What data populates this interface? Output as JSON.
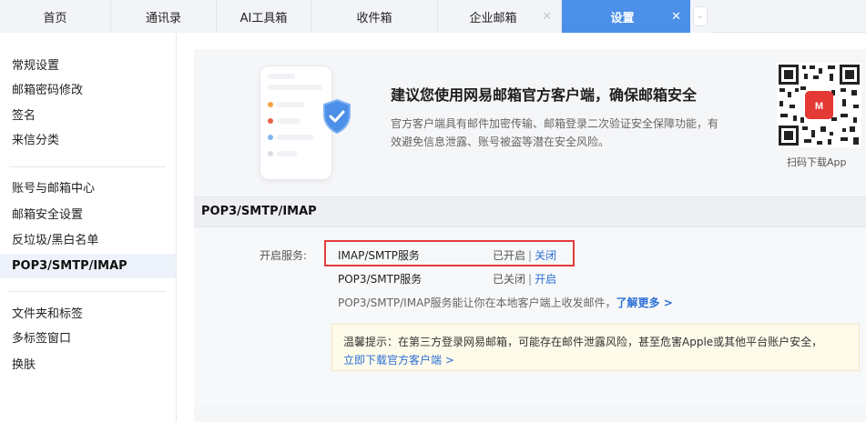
{
  "tabs": [
    {
      "label": "首页",
      "closable": false
    },
    {
      "label": "通讯录",
      "closable": false
    },
    {
      "label": "AI工具箱",
      "closable": false
    },
    {
      "label": "收件箱",
      "closable": false
    },
    {
      "label": "企业邮箱",
      "closable": true
    },
    {
      "label": "设置",
      "closable": true,
      "active": true
    }
  ],
  "sidebar": {
    "group1": [
      "常规设置",
      "邮箱密码修改",
      "签名",
      "来信分类"
    ],
    "group2": [
      "账号与邮箱中心",
      "邮箱安全设置",
      "反垃圾/黑白名单",
      "POP3/SMTP/IMAP"
    ],
    "group3": [
      "文件夹和标签",
      "多标签窗口",
      "换肤"
    ],
    "active": "POP3/SMTP/IMAP"
  },
  "banner": {
    "title": "建议您使用网易邮箱官方客户端，确保邮箱安全",
    "desc": "官方客户端具有邮件加密传输、邮箱登录二次验证安全保障功能，有效避免信息泄露、账号被盗等潜在安全风险。",
    "qr_caption": "扫码下载App",
    "accent": "#4c8fe8"
  },
  "section": {
    "title": "POP3/SMTP/IMAP",
    "service_label": "开启服务:",
    "services": [
      {
        "name": "IMAP/SMTP服务",
        "status": "已开启",
        "action": "关闭"
      },
      {
        "name": "POP3/SMTP服务",
        "status": "已关闭",
        "action": "开启"
      }
    ],
    "desc": "POP3/SMTP/IMAP服务能让你在本地客户端上收发邮件，",
    "learn_more": "了解更多 >",
    "tip_text": "温馨提示：在第三方登录网易邮箱，可能存在邮件泄露风险，甚至危害Apple或其他平台账户安全，",
    "tip_link": "立即下载官方客户端 >"
  }
}
